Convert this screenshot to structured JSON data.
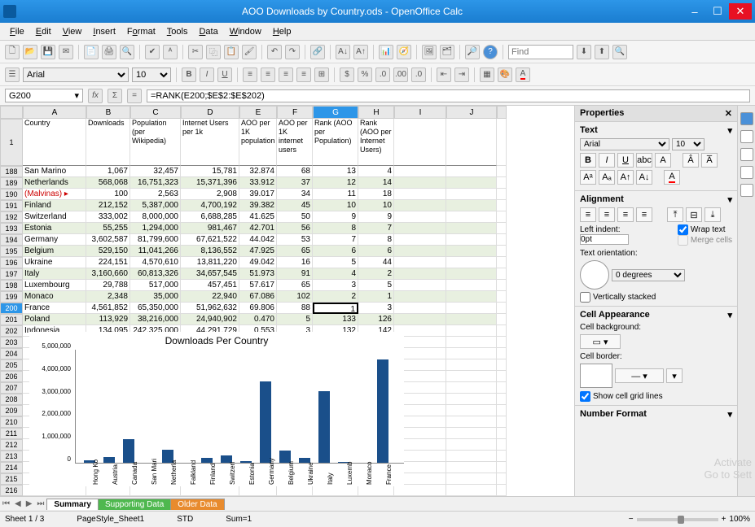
{
  "title": "AOO Downloads by Country.ods - OpenOffice Calc",
  "menu": {
    "file": "File",
    "edit": "Edit",
    "view": "View",
    "insert": "Insert",
    "format": "Format",
    "tools": "Tools",
    "data": "Data",
    "window": "Window",
    "help": "Help"
  },
  "find_placeholder": "Find",
  "font_name": "Arial",
  "font_size": "10",
  "name_box": "G200",
  "formula": "=RANK(E200;$E$2:$E$202)",
  "columns": [
    "A",
    "B",
    "C",
    "D",
    "E",
    "F",
    "G",
    "H",
    "I",
    "J"
  ],
  "selected_col": "G",
  "header_row_num": "1",
  "headers": {
    "A": "Country",
    "B": "Downloads",
    "C": "Population (per Wikipedia)",
    "D": "Internet Users per 1k",
    "E": "AOO per 1K population",
    "F": "AOO per 1K internet users",
    "G": "Rank (AOO per Population)",
    "H": "Rank (AOO per Internet Users)"
  },
  "rows": [
    {
      "n": "188",
      "a": "San Marino",
      "b": "1,067",
      "c": "32,457",
      "d": "15,781",
      "e": "32.874",
      "f": "68",
      "g": "13",
      "h": "4",
      "alt": false
    },
    {
      "n": "189",
      "a": "Netherlands",
      "b": "568,068",
      "c": "16,751,323",
      "d": "15,371,396",
      "e": "33.912",
      "f": "37",
      "g": "12",
      "h": "14",
      "alt": true
    },
    {
      "n": "190",
      "a": "(Malvinas)",
      "b": "100",
      "c": "2,563",
      "d": "2,908",
      "e": "39.017",
      "f": "34",
      "g": "11",
      "h": "18",
      "alt": false,
      "red": true,
      "mark": true
    },
    {
      "n": "191",
      "a": "Finland",
      "b": "212,152",
      "c": "5,387,000",
      "d": "4,700,192",
      "e": "39.382",
      "f": "45",
      "g": "10",
      "h": "10",
      "alt": true
    },
    {
      "n": "192",
      "a": "Switzerland",
      "b": "333,002",
      "c": "8,000,000",
      "d": "6,688,285",
      "e": "41.625",
      "f": "50",
      "g": "9",
      "h": "9",
      "alt": false
    },
    {
      "n": "193",
      "a": "Estonia",
      "b": "55,255",
      "c": "1,294,000",
      "d": "981,467",
      "e": "42.701",
      "f": "56",
      "g": "8",
      "h": "7",
      "alt": true
    },
    {
      "n": "194",
      "a": "Germany",
      "b": "3,602,587",
      "c": "81,799,600",
      "d": "67,621,522",
      "e": "44.042",
      "f": "53",
      "g": "7",
      "h": "8",
      "alt": false
    },
    {
      "n": "195",
      "a": "Belgium",
      "b": "529,150",
      "c": "11,041,266",
      "d": "8,136,552",
      "e": "47.925",
      "f": "65",
      "g": "6",
      "h": "6",
      "alt": true
    },
    {
      "n": "196",
      "a": "Ukraine",
      "b": "224,151",
      "c": "4,570,610",
      "d": "13,811,220",
      "e": "49.042",
      "f": "16",
      "g": "5",
      "h": "44",
      "alt": false
    },
    {
      "n": "197",
      "a": "Italy",
      "b": "3,160,660",
      "c": "60,813,326",
      "d": "34,657,545",
      "e": "51.973",
      "f": "91",
      "g": "4",
      "h": "2",
      "alt": true
    },
    {
      "n": "198",
      "a": "Luxembourg",
      "b": "29,788",
      "c": "517,000",
      "d": "457,451",
      "e": "57.617",
      "f": "65",
      "g": "3",
      "h": "5",
      "alt": false
    },
    {
      "n": "199",
      "a": "Monaco",
      "b": "2,348",
      "c": "35,000",
      "d": "22,940",
      "e": "67.086",
      "f": "102",
      "g": "2",
      "h": "1",
      "alt": true
    },
    {
      "n": "200",
      "a": "France",
      "b": "4,561,852",
      "c": "65,350,000",
      "d": "51,962,632",
      "e": "69.806",
      "f": "88",
      "g": "1",
      "h": "3",
      "alt": false,
      "sel": true
    },
    {
      "n": "201",
      "a": "Poland",
      "b": "113,929",
      "c": "38,216,000",
      "d": "24,940,902",
      "e": "0.470",
      "f": "5",
      "g": "133",
      "h": "126",
      "alt": true
    },
    {
      "n": "202",
      "a": "Indonesia",
      "b": "134,095",
      "c": "242,325,000",
      "d": "44,291,729",
      "e": "0.553",
      "f": "3",
      "g": "132",
      "h": "142",
      "alt": false
    }
  ],
  "empty_rows": [
    "203",
    "204",
    "205",
    "206",
    "207",
    "208",
    "209",
    "210",
    "211",
    "212",
    "213",
    "214",
    "215",
    "216"
  ],
  "chart_data": {
    "type": "bar",
    "title": "Downloads Per Country",
    "ylabel": "",
    "ylim": [
      0,
      5000000
    ],
    "yticks": [
      "0",
      "1,000,000",
      "2,000,000",
      "3,000,000",
      "4,000,000",
      "5,000,000"
    ],
    "categories": [
      "Hong Ko",
      "Austria",
      "Canada",
      "San Mari",
      "Netherla",
      "Falkland",
      "Finland",
      "Switzerl",
      "Estonia",
      "Germany",
      "Belgium",
      "Ukraine",
      "Italy",
      "Luxemb",
      "Monaco",
      "France"
    ],
    "values": [
      120000,
      250000,
      1050000,
      1067,
      568068,
      100,
      212152,
      333002,
      55255,
      3602587,
      529150,
      224151,
      3160660,
      29788,
      2348,
      4561852
    ]
  },
  "sheet_tabs": {
    "s1": "Summary",
    "s2": "Supporting Data",
    "s3": "Older Data"
  },
  "status": {
    "sheet": "Sheet 1 / 3",
    "style": "PageStyle_Sheet1",
    "mode": "STD",
    "sum": "Sum=1",
    "zoom": "100%"
  },
  "properties": {
    "title": "Properties",
    "text": "Text",
    "alignment": "Alignment",
    "left_indent": "Left indent:",
    "indent_val": "0pt",
    "wrap": "Wrap text",
    "merge": "Merge cells",
    "orient": "Text orientation:",
    "degrees": "0 degrees",
    "vstack": "Vertically stacked",
    "cell_app": "Cell Appearance",
    "cell_bg": "Cell background:",
    "cell_border": "Cell border:",
    "gridlines": "Show cell grid lines",
    "numfmt": "Number Format"
  },
  "watermark": {
    "l1": "Activate",
    "l2": "Go to Sett"
  }
}
